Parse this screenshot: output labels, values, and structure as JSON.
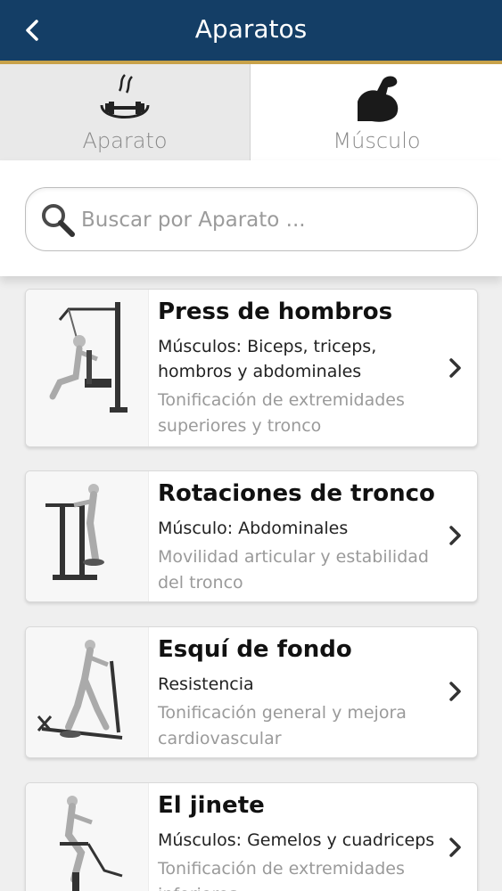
{
  "header": {
    "title": "Aparatos"
  },
  "tabs": [
    {
      "label": "Aparato",
      "icon": "equipment-icon"
    },
    {
      "label": "Músculo",
      "icon": "muscle-icon"
    }
  ],
  "search": {
    "placeholder": "Buscar por Aparato ..."
  },
  "items": [
    {
      "title": "Press de hombros",
      "subtitle": "Músculos: Biceps, triceps, hombros y abdominales",
      "description": "Tonificación de extremidades superiores y tronco"
    },
    {
      "title": "Rotaciones de tronco",
      "subtitle": "Músculo: Abdominales",
      "description": "Movilidad articular y estabilidad del tronco"
    },
    {
      "title": "Esquí de fondo",
      "subtitle": "Resistencia",
      "description": "Tonificación general y mejora cardiovascular"
    },
    {
      "title": "El jinete",
      "subtitle": "Músculos: Gemelos y cuadriceps",
      "description": "Tonificación de extremidades inferiores"
    }
  ],
  "colors": {
    "header": "#143e66",
    "accent": "#c8a24a"
  }
}
